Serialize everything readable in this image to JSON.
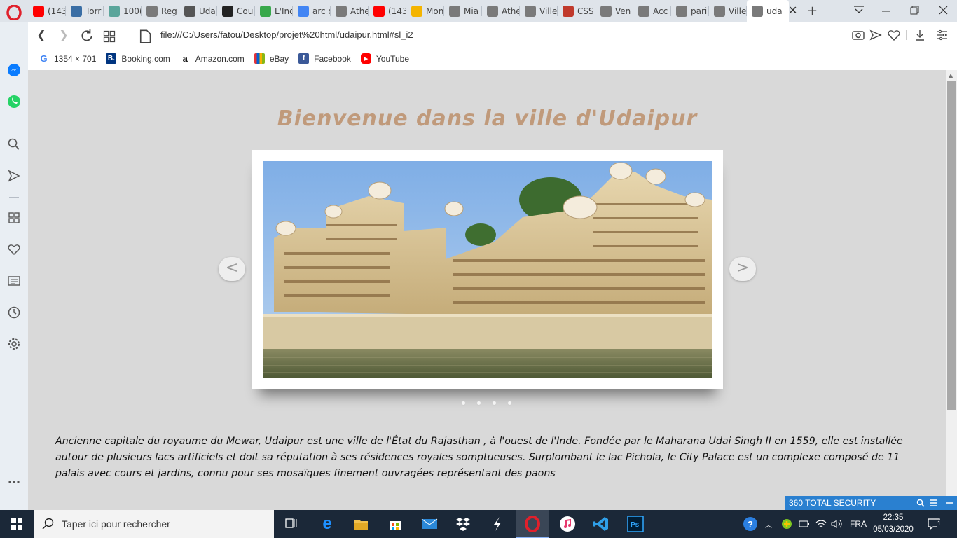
{
  "browser": {
    "tabs": [
      {
        "title": "(143",
        "icon": "youtube-icon",
        "color": "#ff0000"
      },
      {
        "title": "Torr",
        "icon": "t9-icon",
        "color": "#3a6ea5"
      },
      {
        "title": "100(",
        "icon": "d-icon",
        "color": "#5aa59b"
      },
      {
        "title": "Reg",
        "icon": "page-icon",
        "color": "#7a7a7a"
      },
      {
        "title": "Uda",
        "icon": "bird-icon",
        "color": "#555555"
      },
      {
        "title": "Cou",
        "icon": "codepen-icon",
        "color": "#222222"
      },
      {
        "title": "L'Ind",
        "icon": "px-icon",
        "color": "#38a84b"
      },
      {
        "title": "arc d",
        "icon": "google-icon",
        "color": "#4285f4"
      },
      {
        "title": "Athe",
        "icon": "page-icon",
        "color": "#7a7a7a"
      },
      {
        "title": "(143",
        "icon": "youtube-icon",
        "color": "#ff0000"
      },
      {
        "title": "Mon",
        "icon": "drive-icon",
        "color": "#f4b400"
      },
      {
        "title": "Mia",
        "icon": "page-icon",
        "color": "#7a7a7a"
      },
      {
        "title": "Athe",
        "icon": "page-icon",
        "color": "#7a7a7a"
      },
      {
        "title": "Ville",
        "icon": "page-icon",
        "color": "#7a7a7a"
      },
      {
        "title": "CSS",
        "icon": "css-icon",
        "color": "#c0392b"
      },
      {
        "title": "Ven",
        "icon": "page-icon",
        "color": "#7a7a7a"
      },
      {
        "title": "Acc",
        "icon": "grid-icon",
        "color": "#7a7a7a"
      },
      {
        "title": "pari",
        "icon": "page-icon",
        "color": "#7a7a7a"
      },
      {
        "title": "Ville",
        "icon": "page-icon",
        "color": "#7a7a7a"
      },
      {
        "title": "uda",
        "icon": "page-icon",
        "color": "#7a7a7a",
        "active": true
      }
    ],
    "url": "file:///C:/Users/fatou/Desktop/projet%20html/udaipur.html#sl_i2",
    "bookmarks": [
      {
        "label": "1354 × 701",
        "icon": "google-icon"
      },
      {
        "label": "Booking.com",
        "icon": "booking-icon"
      },
      {
        "label": "Amazon.com",
        "icon": "amazon-icon"
      },
      {
        "label": "eBay",
        "icon": "ebay-icon"
      },
      {
        "label": "Facebook",
        "icon": "facebook-icon"
      },
      {
        "label": "YouTube",
        "icon": "youtube-icon"
      }
    ]
  },
  "page": {
    "title": "Bienvenue dans la ville d'Udaipur",
    "prev_label": "<",
    "next_label": ">",
    "description": "Ancienne capitale du royaume du Mewar, Udaipur est une ville de l'État du Rajasthan , à l'ouest de l'Inde. Fondée par le Maharana Udai Singh II en 1559, elle est installée autour de plusieurs lacs artificiels et doit sa réputation à ses résidences royales somptueuses. Surplombant le lac Pichola, le City Palace est un complexe composé de 11 palais avec cours et jardins, connu pour ses mosaïques finement ouvragées représentant des paons",
    "title_color": "#c09a7b"
  },
  "security_banner": "360 TOTAL SECURITY",
  "taskbar": {
    "search_placeholder": "Taper ici pour rechercher",
    "language": "FRA",
    "time": "22:35",
    "date": "05/03/2020",
    "notification_count": "1"
  }
}
